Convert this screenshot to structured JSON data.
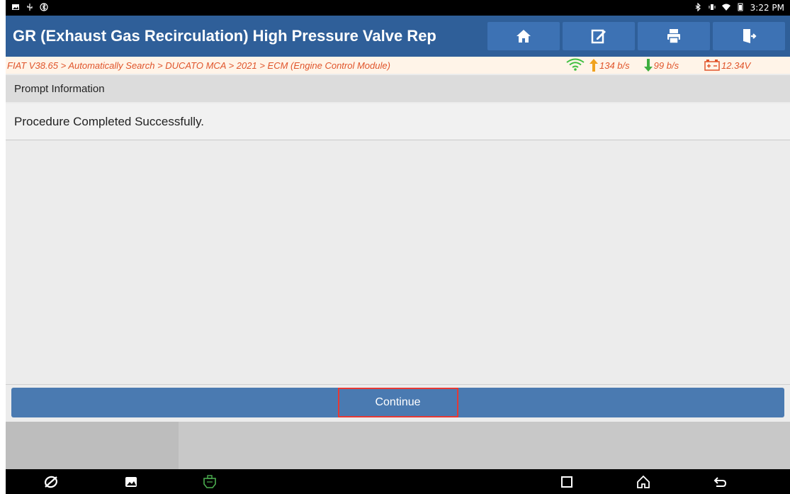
{
  "status_bar": {
    "time": "3:22 PM",
    "left_icons": [
      "image-icon",
      "usb-icon",
      "bluetooth-circle-icon"
    ],
    "right_icons": [
      "bluetooth-icon",
      "vibrate-icon",
      "wifi-icon",
      "battery-icon"
    ]
  },
  "titlebar": {
    "title": "GR (Exhaust Gas Recirculation) High Pressure Valve Rep",
    "buttons": [
      "home-icon",
      "edit-icon",
      "print-icon",
      "exit-icon"
    ]
  },
  "breadcrumb": {
    "path": "FIAT V38.65 > Automatically Search > DUCATO MCA > 2021 > ECM (Engine Control Module)",
    "upload_rate": "134 b/s",
    "download_rate": "99 b/s",
    "voltage": "12.34V"
  },
  "prompt": {
    "header": "Prompt Information",
    "message": "Procedure Completed Successfully."
  },
  "actions": {
    "continue_label": "Continue"
  },
  "navbar": {
    "left_icons": [
      "browser-icon",
      "gallery-icon",
      "vci-icon"
    ],
    "right_icons": [
      "recents-icon",
      "home-nav-icon",
      "back-icon"
    ]
  },
  "colors": {
    "title_bar": "#2f5f99",
    "title_button": "#3d72b4",
    "breadcrumb_text": "#e0542a",
    "continue_bar": "#4a7ab1",
    "highlight_border": "#e53935",
    "wifi_green": "#3fbf3f",
    "vci_green": "#4caf50"
  }
}
